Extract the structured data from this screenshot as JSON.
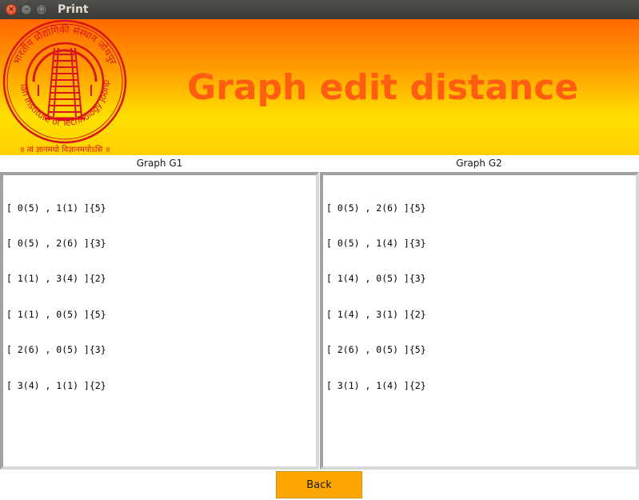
{
  "window": {
    "title": "Print",
    "buttons": {
      "close": "×",
      "minimize": "–",
      "maximize": "□"
    }
  },
  "banner": {
    "title": "Graph edit distance",
    "logo": {
      "outer_text": "भारतीय प्रौद्योगिकी संस्थान जोधपुर",
      "inner_text": "Indian Institute of Technology Jodhpur",
      "motto": "॥ त्वं ज्ञानमयो विज्ञानमयोऽसि ॥",
      "color": "#d9141b"
    }
  },
  "panels": {
    "g1": {
      "label": "Graph G1",
      "lines": [
        "[ 0(5) , 1(1) ]{5}",
        "[ 0(5) , 2(6) ]{3}",
        "[ 1(1) , 3(4) ]{2}",
        "[ 1(1) , 0(5) ]{5}",
        "[ 2(6) , 0(5) ]{3}",
        "[ 3(4) , 1(1) ]{2}"
      ]
    },
    "g2": {
      "label": "Graph G2",
      "lines": [
        "[ 0(5) , 2(6) ]{5}",
        "[ 0(5) , 1(4) ]{3}",
        "[ 1(4) , 0(5) ]{3}",
        "[ 1(4) , 3(1) ]{2}",
        "[ 2(6) , 0(5) ]{5}",
        "[ 3(1) , 1(4) ]{2}"
      ]
    }
  },
  "actions": {
    "back_label": "Back"
  },
  "colors": {
    "banner_top": "#ff6a00",
    "banner_bottom": "#ffe000",
    "title_text": "#ff5e10",
    "back_button": "#ffa500"
  }
}
